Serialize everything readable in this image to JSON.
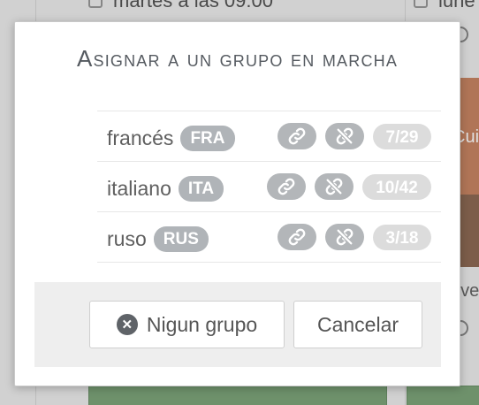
{
  "background": {
    "top_left_text": "martes a las 09:00",
    "top_right_text": "lune",
    "card_text": "Cui",
    "side_text": "eve"
  },
  "modal": {
    "title": "Asignar a un grupo en marcha",
    "groups": [
      {
        "name": "francés",
        "code": "FRA",
        "count": "7/29"
      },
      {
        "name": "italiano",
        "code": "ITA",
        "count": "10/42"
      },
      {
        "name": "ruso",
        "code": "RUS",
        "count": "3/18"
      }
    ],
    "footer": {
      "no_group_label": "Nigun grupo",
      "cancel_label": "Cancelar"
    }
  },
  "colors": {
    "badge": "#b0b4b8",
    "count_pill": "#dcdcdc",
    "title": "#555a60"
  }
}
